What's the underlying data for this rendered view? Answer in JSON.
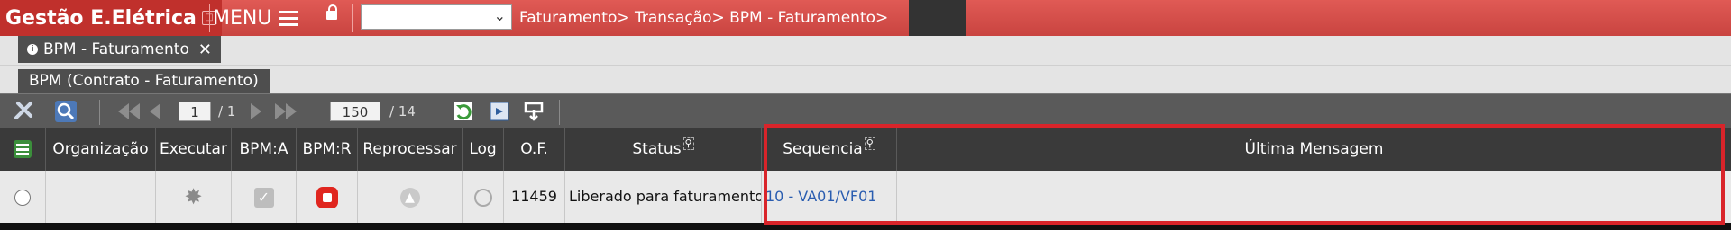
{
  "app": {
    "title": "Gestão E.Elétrica",
    "window_icon": "window-icon"
  },
  "menu": {
    "label": "MENU"
  },
  "breadcrumb": {
    "text": "Faturamento> Transação> BPM - Faturamento>"
  },
  "select": {
    "value": ""
  },
  "tab": {
    "label": "BPM - Faturamento",
    "close": "✕"
  },
  "subtitle": {
    "label": "BPM (Contrato - Faturamento)"
  },
  "pager": {
    "page": "1",
    "pages_text": "/ 1",
    "page_size": "150",
    "total_text": "/ 14"
  },
  "table": {
    "headers": {
      "organizacao": "Organização",
      "executar": "Executar",
      "bpm_a": "BPM:A",
      "bpm_r": "BPM:R",
      "reprocessar": "Reprocessar",
      "log": "Log",
      "of": "O.F.",
      "status": "Status",
      "sequencia": "Sequencia",
      "ultima_mensagem": "Última Mensagem"
    },
    "rows": [
      {
        "organizacao": "",
        "of": "11459",
        "status": "Liberado para faturamento",
        "sequencia": "10 - VA01/VF01",
        "ultima_mensagem": ""
      }
    ]
  },
  "colors": {
    "topbar": "#d9534f",
    "title_bg": "#c0302c",
    "header_bg": "#3a3a3a",
    "highlight": "#d9242a",
    "link": "#2a5db0"
  }
}
